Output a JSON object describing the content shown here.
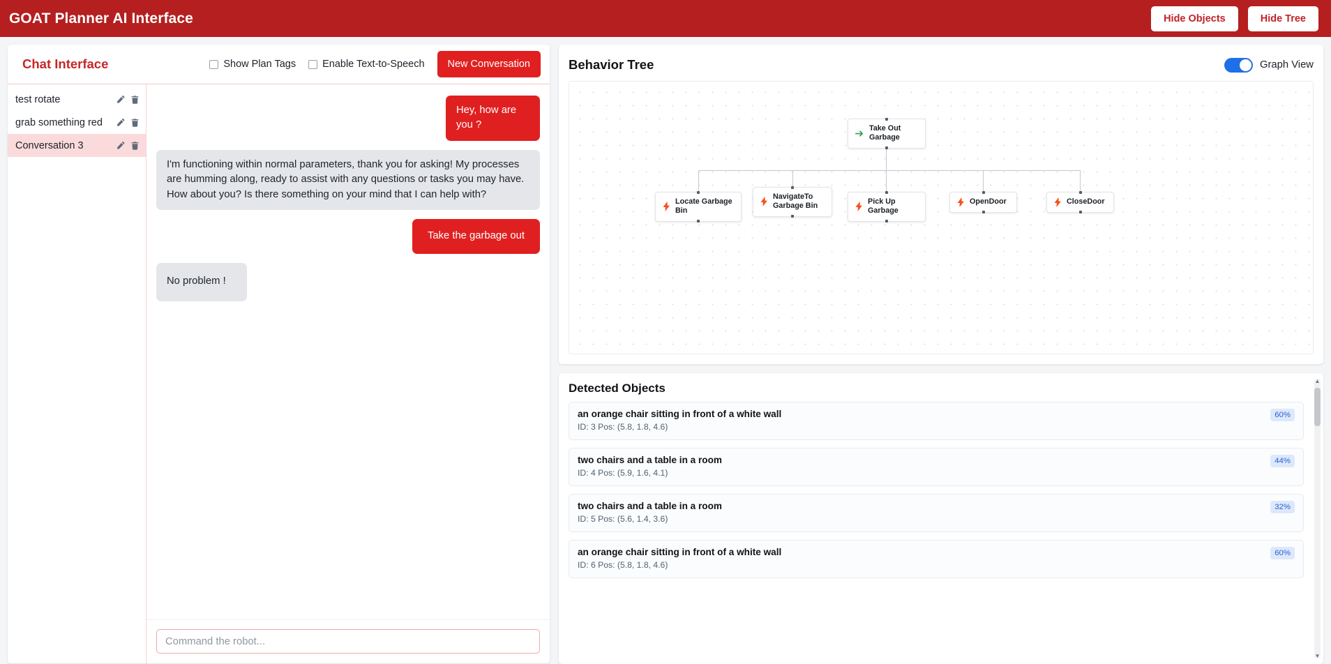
{
  "appbar": {
    "title": "GOAT Planner AI Interface",
    "hide_objects_label": "Hide Objects",
    "hide_tree_label": "Hide Tree"
  },
  "chat": {
    "title": "Chat Interface",
    "show_plan_tags_label": "Show Plan Tags",
    "enable_tts_label": "Enable Text-to-Speech",
    "new_conversation_label": "New Conversation",
    "conversations": [
      {
        "name": "test rotate",
        "active": false
      },
      {
        "name": "grab something red",
        "active": false
      },
      {
        "name": "Conversation 3",
        "active": true
      }
    ],
    "messages": [
      {
        "role": "user",
        "text": "Hey, how are you ?"
      },
      {
        "role": "bot",
        "text": "I'm functioning within normal parameters, thank you for asking! My processes are humming along, ready to assist with any questions or tasks you may have. How about you? Is there something on your mind that I can help with?"
      },
      {
        "role": "user",
        "text": "Take the garbage out"
      },
      {
        "role": "bot",
        "text": "No problem !"
      }
    ],
    "composer_placeholder": "Command the robot...",
    "composer_value": ""
  },
  "tree": {
    "title": "Behavior Tree",
    "graph_view_label": "Graph View",
    "graph_view_on": true,
    "root": {
      "label": "Take Out Garbage",
      "icon": "arrow-right-icon"
    },
    "children": [
      {
        "label": "Locate Garbage Bin",
        "icon": "lightning-icon"
      },
      {
        "label": "NavigateTo Garbage Bin",
        "icon": "lightning-icon"
      },
      {
        "label": "Pick Up Garbage",
        "icon": "lightning-icon"
      },
      {
        "label": "OpenDoor",
        "icon": "lightning-icon"
      },
      {
        "label": "CloseDoor",
        "icon": "lightning-icon"
      }
    ]
  },
  "objects": {
    "title": "Detected Objects",
    "items": [
      {
        "desc": "an orange chair sitting in front of a white wall",
        "meta": "ID: 3   Pos: (5.8, 1.8, 4.6)",
        "conf": "60%"
      },
      {
        "desc": "two chairs and a table in a room",
        "meta": "ID: 4   Pos: (5.9, 1.6, 4.1)",
        "conf": "44%"
      },
      {
        "desc": "two chairs and a table in a room",
        "meta": "ID: 5   Pos: (5.6, 1.4, 3.6)",
        "conf": "32%"
      },
      {
        "desc": "an orange chair sitting in front of a white wall",
        "meta": "ID: 6   Pos: (5.8, 1.8, 4.6)",
        "conf": "60%"
      }
    ]
  },
  "colors": {
    "brand_red": "#b51f1f",
    "button_red": "#e02020",
    "accent_blue": "#1f6fe8",
    "node_icon_orange": "#f4511e",
    "node_icon_green": "#2e9e4f"
  }
}
